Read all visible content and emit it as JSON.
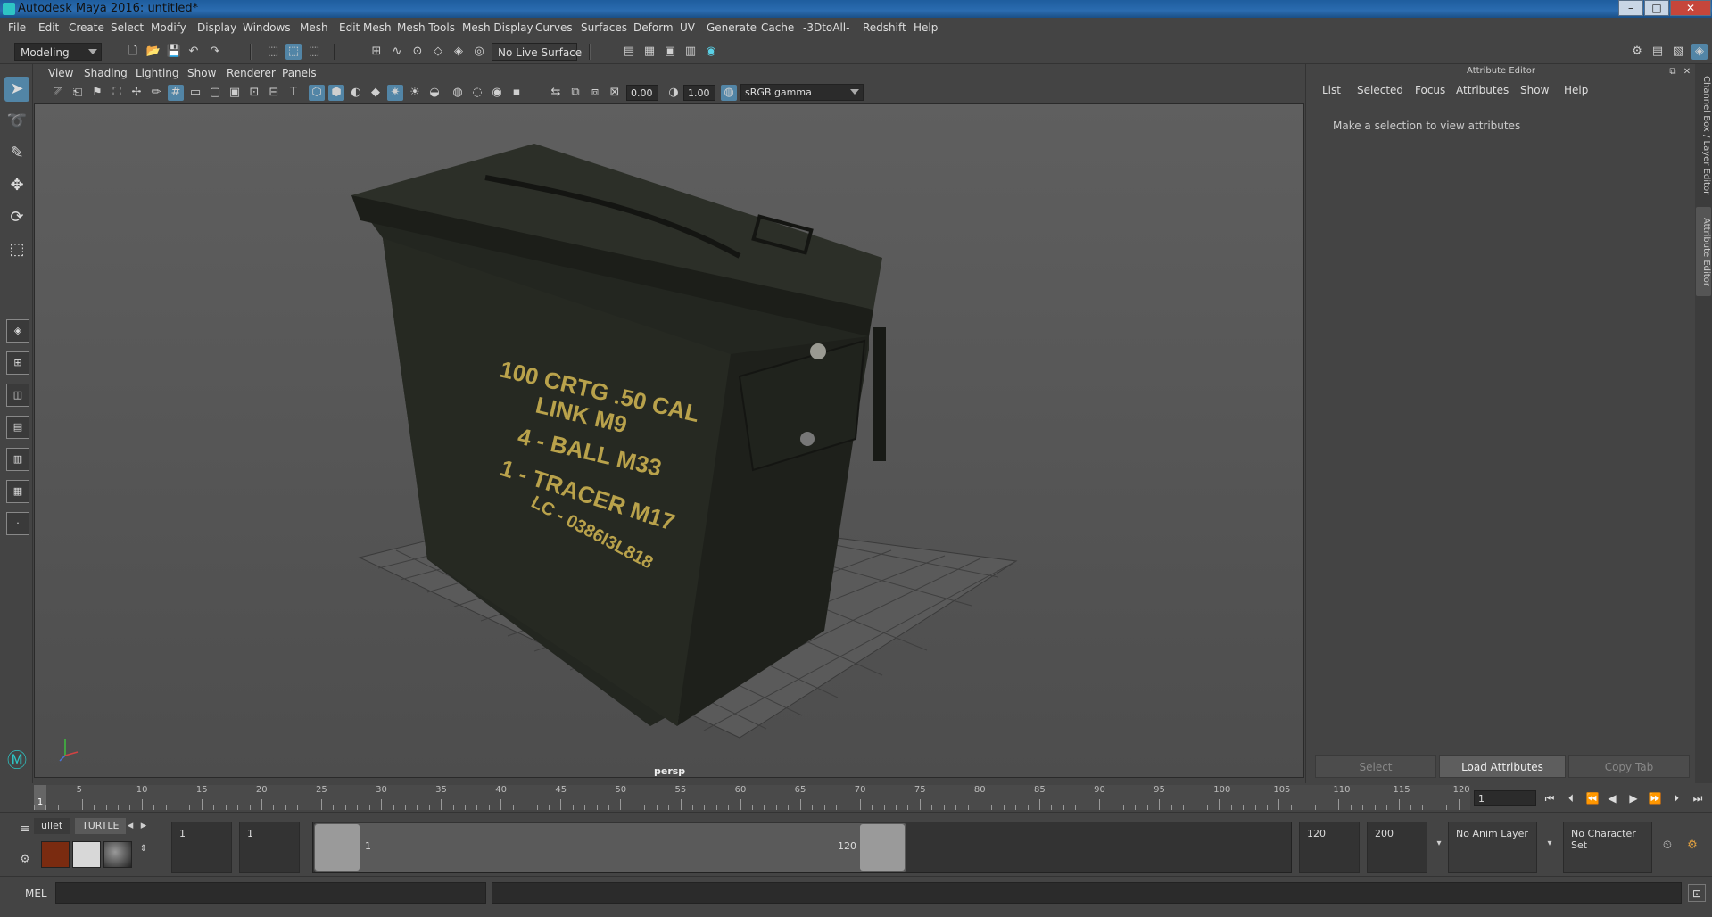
{
  "window": {
    "title": "Autodesk Maya 2016: untitled*",
    "minimize": "–",
    "maximize": "□",
    "close": "✕"
  },
  "menubar": [
    "File",
    "Edit",
    "Create",
    "Select",
    "Modify",
    "Display",
    "Windows",
    "Mesh",
    "Edit Mesh",
    "Mesh Tools",
    "Mesh Display",
    "Curves",
    "Surfaces",
    "Deform",
    "UV",
    "Generate",
    "Cache",
    "-3DtoAll-",
    "Redshift",
    "Help"
  ],
  "status": {
    "mode": "Modeling",
    "live_surface": "No Live Surface"
  },
  "panel_menu": [
    "View",
    "Shading",
    "Lighting",
    "Show",
    "Renderer",
    "Panels"
  ],
  "panel_bar": {
    "exposure": "0.00",
    "gamma": "1.00",
    "color_space": "sRGB gamma"
  },
  "viewport": {
    "camera": "persp",
    "stencil": [
      "100 CRTG  .50 CAL",
      "LINK   M9",
      "4 - BALL   M33",
      "1 - TRACER  M17",
      "LC - 0386I3L818"
    ]
  },
  "attribute_editor": {
    "header": "Attribute Editor",
    "menu": [
      "List",
      "Selected",
      "Focus",
      "Attributes",
      "Show",
      "Help"
    ],
    "message": "Make a selection to view attributes",
    "buttons": {
      "select": "Select",
      "load": "Load Attributes",
      "copy": "Copy Tab"
    }
  },
  "side_tabs": {
    "channel_box": "Channel Box / Layer Editor",
    "attr_editor": "Attribute Editor"
  },
  "timeline": {
    "ticks": [
      "5",
      "10",
      "15",
      "20",
      "25",
      "30",
      "35",
      "40",
      "45",
      "50",
      "55",
      "60",
      "65",
      "70",
      "75",
      "80",
      "85",
      "90",
      "95",
      "100",
      "105",
      "110",
      "115",
      "120"
    ],
    "current_frame_marker": "1",
    "current_frame": "1"
  },
  "range": {
    "start": "1",
    "playback_start": "1",
    "range_start_label": "1",
    "range_end_label": "120",
    "playback_end": "120",
    "end": "200",
    "anim_layer": "No Anim Layer",
    "character_set": "No Character Set"
  },
  "shelf": {
    "tab_bullet": "ullet",
    "tab_turtle": "TURTLE"
  },
  "cmdline": {
    "label": "MEL"
  }
}
